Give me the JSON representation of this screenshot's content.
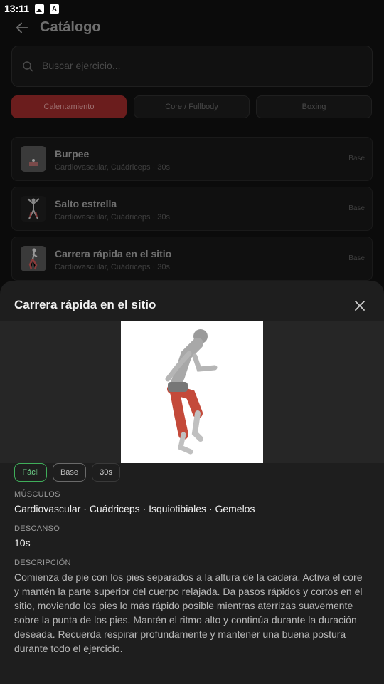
{
  "status": {
    "time": "13:11"
  },
  "header": {
    "title": "Catálogo"
  },
  "search": {
    "placeholder": "Buscar ejercicio..."
  },
  "chips": [
    "Calentamiento",
    "Core / Fullbody",
    "Boxing"
  ],
  "exercises": [
    {
      "name": "Burpee",
      "muscles": "Cardiovascular, Cuádriceps",
      "duration": "30s",
      "tag": "Base"
    },
    {
      "name": "Salto estrella",
      "muscles": "Cardiovascular, Cuádriceps",
      "duration": "30s",
      "tag": "Base"
    },
    {
      "name": "Carrera rápida en el sitio",
      "muscles": "Cardiovascular, Cuádriceps",
      "duration": "30s",
      "tag": "Base"
    }
  ],
  "detail": {
    "title": "Carrera rápida en el sitio",
    "difficulty": "Fácil",
    "level": "Base",
    "duration": "30s",
    "muscles_label": "MÚSCULOS",
    "muscles": "Cardiovascular · Cuádriceps · Isquiotibiales · Gemelos",
    "rest_label": "DESCANSO",
    "rest": "10s",
    "description_label": "DESCRIPCIÓN",
    "description": "Comienza de pie con los pies separados a la altura de la cadera. Activa el core y mantén la parte superior del cuerpo relajada. Da pasos rápidos y cortos en el sitio, moviendo los pies lo más rápido posible mientras aterrizas suavemente sobre la punta de los pies. Mantén el ritmo alto y continúa durante la duración deseada. Recuerda respirar profundamente y mantener una buena postura durante todo el ejercicio."
  },
  "colors": {
    "accent": "#6b1d1d",
    "easy": "#3fae5a",
    "sheet": "#1e1e1e"
  }
}
